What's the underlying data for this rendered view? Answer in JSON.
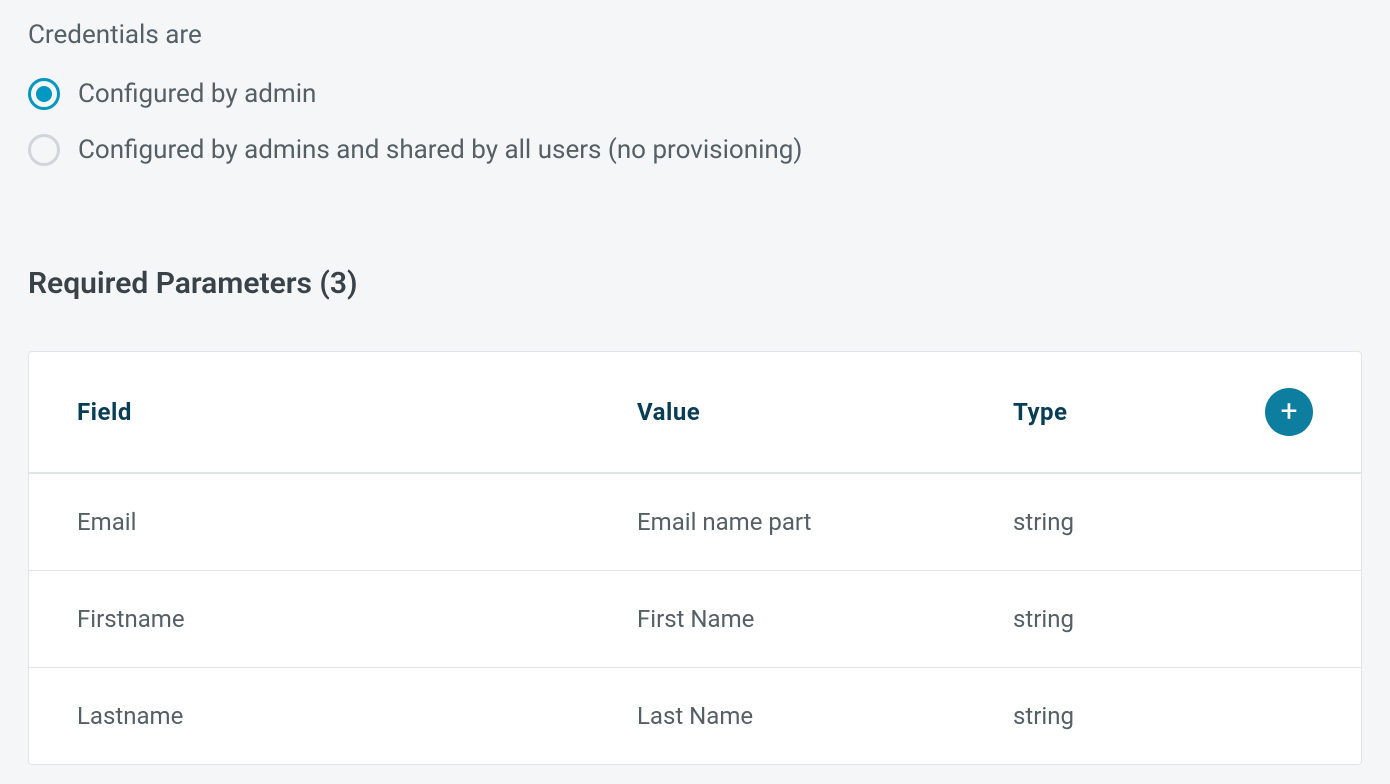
{
  "credentials": {
    "label": "Credentials are",
    "options": [
      {
        "label": "Configured by admin",
        "selected": true
      },
      {
        "label": "Configured by admins and shared by all users (no provisioning)",
        "selected": false
      }
    ]
  },
  "parameters": {
    "title": "Required Parameters (3)",
    "columns": {
      "field": "Field",
      "value": "Value",
      "type": "Type"
    },
    "rows": [
      {
        "field": "Email",
        "value": "Email name part",
        "type": "string"
      },
      {
        "field": "Firstname",
        "value": "First Name",
        "type": "string"
      },
      {
        "field": "Lastname",
        "value": "Last Name",
        "type": "string"
      }
    ]
  }
}
